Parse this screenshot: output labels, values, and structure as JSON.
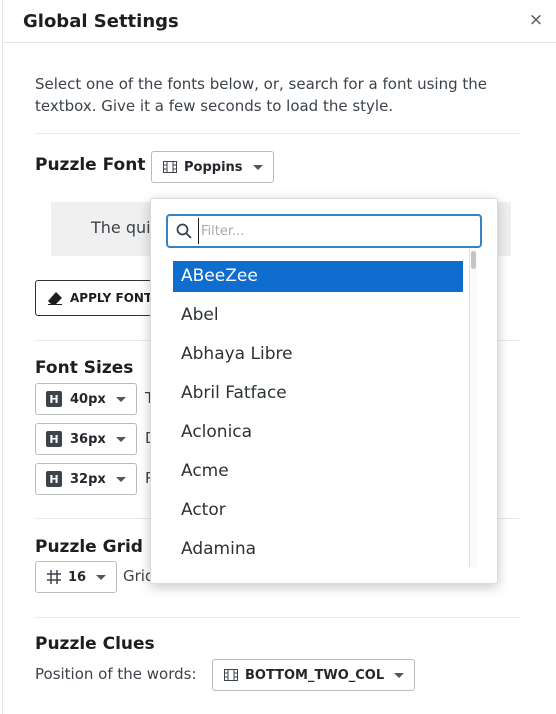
{
  "header": {
    "title": "Global Settings",
    "close_glyph": "×"
  },
  "description": "Select one of the fonts below, or, search for a font using the textbox. Give it a few seconds to load the style.",
  "puzzle_font": {
    "title": "Puzzle Font",
    "selected": "Poppins",
    "preview_text": "The qui",
    "apply_label": "APPLY FONT"
  },
  "font_sizes": {
    "title": "Font Sizes",
    "rows": [
      {
        "badge": "H",
        "value": "40px",
        "label": "T"
      },
      {
        "badge": "H",
        "value": "36px",
        "label": "D"
      },
      {
        "badge": "H",
        "value": "32px",
        "label": "P"
      }
    ]
  },
  "puzzle_grid": {
    "title": "Puzzle Grid Si",
    "value": "16",
    "label": "Grid"
  },
  "puzzle_clues": {
    "title": "Puzzle Clues",
    "position_label": "Position of the words:",
    "position_value": "BOTTOM_TWO_COL"
  },
  "font_dropdown": {
    "filter_placeholder": "Filter...",
    "options": [
      "ABeeZee",
      "Abel",
      "Abhaya Libre",
      "Abril Fatface",
      "Aclonica",
      "Acme",
      "Actor",
      "Adamina"
    ],
    "selected_index": 0
  },
  "colors": {
    "accent": "#0f6ecd",
    "focus": "#3582c4",
    "text": "#1e1e1e"
  }
}
